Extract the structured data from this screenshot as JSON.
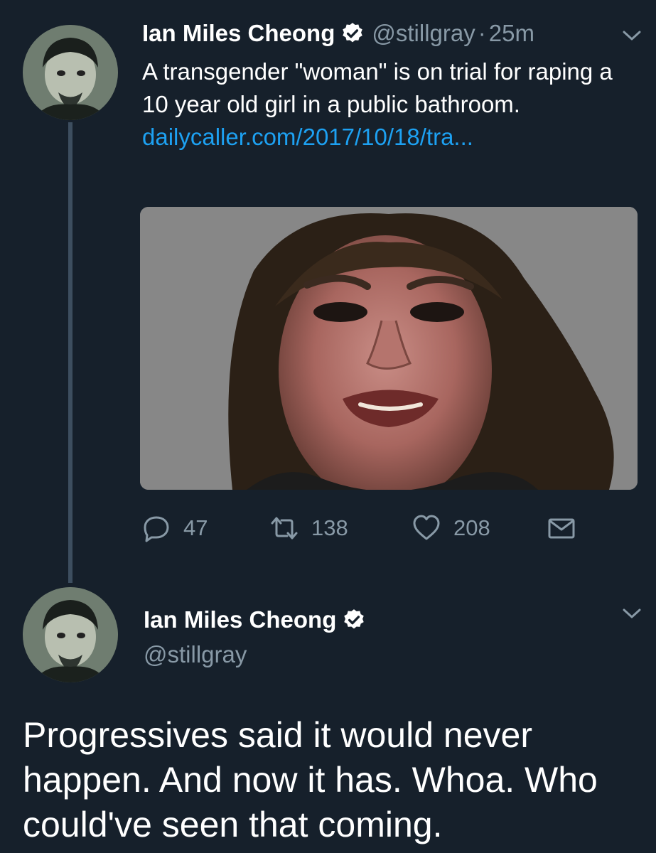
{
  "tweet1": {
    "author_name": "Ian Miles Cheong",
    "handle": "@stillgray",
    "separator": "·",
    "time": "25m",
    "text": "A transgender \"woman\" is on trial for raping a 10 year old girl in a public bathroom. ",
    "link": "dailycaller.com/2017/10/18/tra...",
    "media_icon": "photo",
    "actions": {
      "reply_count": "47",
      "retweet_count": "138",
      "like_count": "208"
    }
  },
  "tweet2": {
    "author_name": "Ian Miles Cheong",
    "handle": "@stillgray",
    "text": "Progressives said it would never happen. And now it has. Whoa. Who could've seen that coming."
  },
  "colors": {
    "background": "#16202b",
    "text": "#ffffff",
    "muted": "#8899a6",
    "link": "#1da1f2",
    "thread_line": "#3d4e5f"
  },
  "icons": [
    "avatar",
    "verified-badge-icon",
    "chevron-down-icon",
    "reply-icon",
    "retweet-icon",
    "heart-icon",
    "envelope-icon"
  ]
}
